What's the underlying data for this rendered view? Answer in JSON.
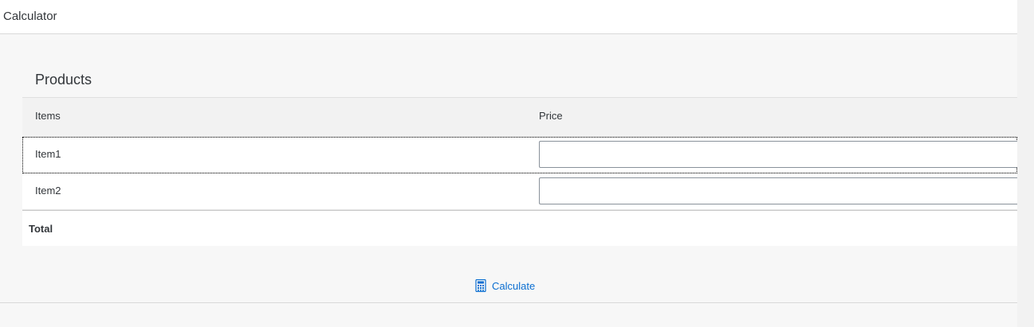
{
  "header": {
    "title": "Calculator"
  },
  "panel": {
    "title": "Products",
    "columns": {
      "items": "Items",
      "price": "Price"
    },
    "rows": [
      {
        "label": "Item1",
        "price_value": ""
      },
      {
        "label": "Item2",
        "price_value": ""
      }
    ],
    "total_label": "Total"
  },
  "actions": {
    "calculate_label": "Calculate",
    "calculate_icon": "calculator-icon"
  },
  "colors": {
    "accent": "#0a6ed1",
    "text": "#32363a",
    "background": "#f7f7f7"
  }
}
